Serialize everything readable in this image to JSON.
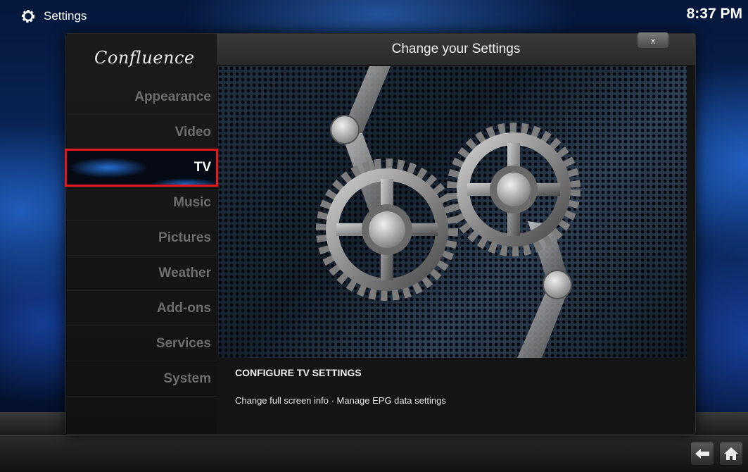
{
  "topbar": {
    "title": "Settings",
    "clock": "8:37 PM",
    "icon": "gear-icon"
  },
  "sidebar": {
    "logo": "Confluence",
    "items": [
      {
        "label": "Appearance",
        "active": false
      },
      {
        "label": "Video",
        "active": false
      },
      {
        "label": "TV",
        "active": true
      },
      {
        "label": "Music",
        "active": false
      },
      {
        "label": "Pictures",
        "active": false
      },
      {
        "label": "Weather",
        "active": false
      },
      {
        "label": "Add-ons",
        "active": false
      },
      {
        "label": "Services",
        "active": false
      },
      {
        "label": "System",
        "active": false
      }
    ]
  },
  "dialog": {
    "title": "Change your Settings",
    "close_label": "x"
  },
  "info": {
    "title": "CONFIGURE TV SETTINGS",
    "description": "Change full screen info · Manage EPG data settings"
  },
  "bottom_nav": {
    "back_icon": "back-arrow-icon",
    "home_icon": "home-icon"
  },
  "colors": {
    "highlight_border": "#e6171c",
    "accent_blue": "#2878e6"
  }
}
